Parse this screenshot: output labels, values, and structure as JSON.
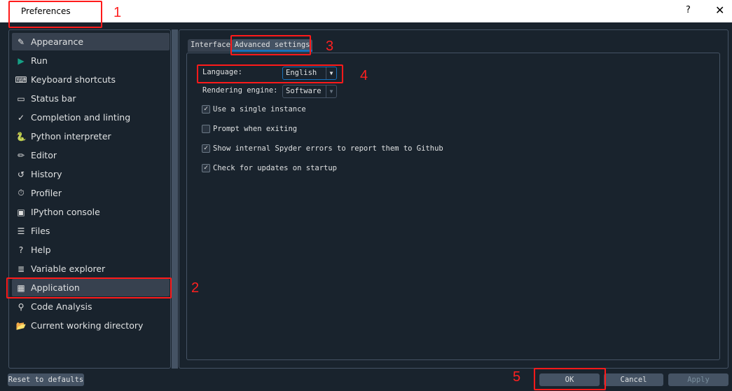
{
  "window": {
    "title": "Preferences",
    "help": "?",
    "close": "✕"
  },
  "sidebar": {
    "items": [
      {
        "label": "Appearance",
        "icon": "✎"
      },
      {
        "label": "Run",
        "icon": "▶"
      },
      {
        "label": "Keyboard shortcuts",
        "icon": "⌨"
      },
      {
        "label": "Status bar",
        "icon": "▭"
      },
      {
        "label": "Completion and linting",
        "icon": "✓"
      },
      {
        "label": "Python interpreter",
        "icon": "🐍"
      },
      {
        "label": "Editor",
        "icon": "✏"
      },
      {
        "label": "History",
        "icon": "↺"
      },
      {
        "label": "Profiler",
        "icon": "⏱"
      },
      {
        "label": "IPython console",
        "icon": "▣"
      },
      {
        "label": "Files",
        "icon": "☰"
      },
      {
        "label": "Help",
        "icon": "?"
      },
      {
        "label": "Variable explorer",
        "icon": "≣"
      },
      {
        "label": "Application",
        "icon": "▦",
        "selected": true
      },
      {
        "label": "Code Analysis",
        "icon": "⚲"
      },
      {
        "label": "Current working directory",
        "icon": "📂"
      }
    ]
  },
  "tabs": [
    {
      "label": "Interface"
    },
    {
      "label": "Advanced settings",
      "active": true
    }
  ],
  "settings": {
    "language_label": "Language:",
    "language_value": "English",
    "engine_label": "Rendering engine:",
    "engine_value": "Software",
    "checks": [
      {
        "label": "Use a single instance",
        "checked": true
      },
      {
        "label": "Prompt when exiting",
        "checked": false
      },
      {
        "label": "Show internal Spyder errors to report them to Github",
        "checked": true
      },
      {
        "label": "Check for updates on startup",
        "checked": true
      }
    ]
  },
  "buttons": {
    "reset": "Reset to defaults",
    "ok": "OK",
    "cancel": "Cancel",
    "apply": "Apply"
  },
  "annotations": [
    "1",
    "2",
    "3",
    "4",
    "5"
  ],
  "colors": {
    "background": "#19232d",
    "selected": "#37414f",
    "button": "#455364",
    "accent": "#1a72bb",
    "annotation": "#ff1a1a"
  }
}
